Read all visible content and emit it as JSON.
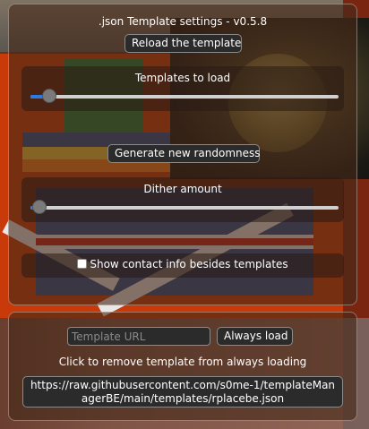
{
  "panel": {
    "title": ".json Template settings - v0.5.8",
    "reload_label": "Reload the template",
    "templates_to_load": {
      "label": "Templates to load",
      "value_fraction": 0.06
    },
    "generate_label": "Generate new randomness",
    "dither_amount": {
      "label": "Dither amount",
      "value_fraction": 0.03
    },
    "contact_info": {
      "label": "Show contact info besides templates",
      "checked": false
    }
  },
  "templates": {
    "url_placeholder": "Template URL",
    "url_value": "",
    "always_load_label": "Always load",
    "remove_hint": "Click to remove template from always loading",
    "saved": [
      "https://raw.githubusercontent.com/s0me-1/templateManagerBE/main/templates/rplacebe.json"
    ]
  },
  "colors": {
    "accent": "#2d7be0",
    "panel_bg": "#46281a",
    "button_bg": "#2b2b2b"
  }
}
